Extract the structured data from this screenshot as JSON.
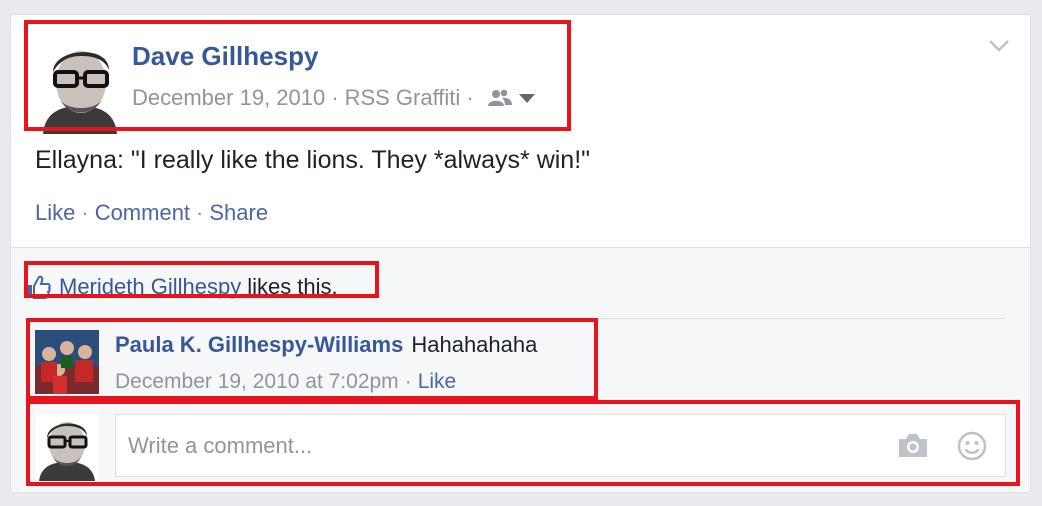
{
  "post": {
    "author": "Dave Gillhespy",
    "date": "December 19, 2010",
    "separator": "·",
    "app": "RSS Graffiti",
    "audience_icon": "friends-icon",
    "text": "Ellayna: \"I really like the lions. They *always* win!\"",
    "actions": {
      "like": "Like",
      "comment": "Comment",
      "share": "Share"
    }
  },
  "likes": {
    "icon": "thumbs-up-icon",
    "person": "Merideth Gillhespy",
    "suffix": "likes this."
  },
  "comment": {
    "author": "Paula K. Gillhespy-Williams",
    "text": "Hahahahaha",
    "timestamp": "December 19, 2010 at 7:02pm",
    "like": "Like"
  },
  "composer": {
    "placeholder": "Write a comment...",
    "icons": [
      "camera-icon",
      "smiley-icon"
    ]
  },
  "colors": {
    "link": "#365899",
    "meta": "#90949c",
    "highlight": "#e8141b"
  }
}
